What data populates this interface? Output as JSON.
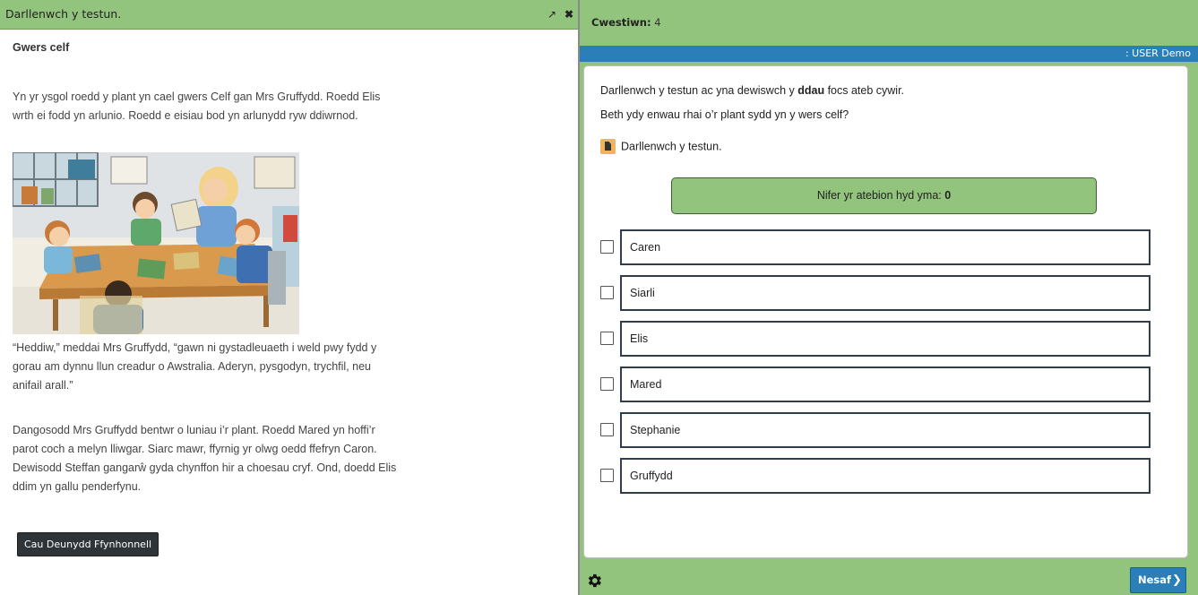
{
  "source_panel": {
    "header_title": "Darllenwch y testun.",
    "minimize_glyph": "↗",
    "close_glyph": "✖",
    "doc_title": "Gwers celf",
    "paragraphs": [
      "Yn yr ysgol roedd y plant yn cael gwers Celf gan Mrs Gruffydd. Roedd Elis wrth ei fodd yn arlunio. Roedd e eisiau bod yn arlunydd ryw ddiwrnod.",
      "“Heddiw,” meddai Mrs Gruffydd, “gawn ni gystadleuaeth i weld pwy fydd y gorau am dynnu llun creadur o Awstralia. Aderyn, pysgodyn, trychfil, neu anifail arall.”",
      "Dangosodd Mrs Gruffydd bentwr o luniau i’r plant. Roedd Mared yn hoffi’r parot coch a melyn lliwgar. Siarc mawr, ffyrnig yr olwg oedd ffefryn Caron. Dewisodd Steffan gangarŵ gyda chynffon hir a choesau cryf. Ond, doedd Elis ddim yn gallu penderfynu."
    ],
    "close_button_label": "Cau Deunydd Ffynhonnell"
  },
  "question_panel": {
    "question_label": "Cwestiwn:",
    "question_number": "4",
    "user_label": ": USER Demo",
    "instruction_pre": "Darllenwch y testun ac yna dewiswch y ",
    "instruction_bold": "ddau",
    "instruction_post": " focs ateb cywir.",
    "question_text": "Beth ydy enwau rhai o’r plant sydd yn y wers celf?",
    "read_text_link": "Darllenwch y testun.",
    "answer_count_label": "Nifer yr atebion hyd yma: ",
    "answer_count_value": "0",
    "options": [
      "Caren",
      "Siarli",
      "Elis",
      "Mared",
      "Stephanie",
      "Gruffydd"
    ],
    "next_button_label": "Nesaf",
    "next_chevron": "❯"
  },
  "colors": {
    "header_green": "#93c47d",
    "user_strip_blue": "#2a7fb8",
    "option_border": "#2f3e4a",
    "dark_button": "#2e3438"
  }
}
